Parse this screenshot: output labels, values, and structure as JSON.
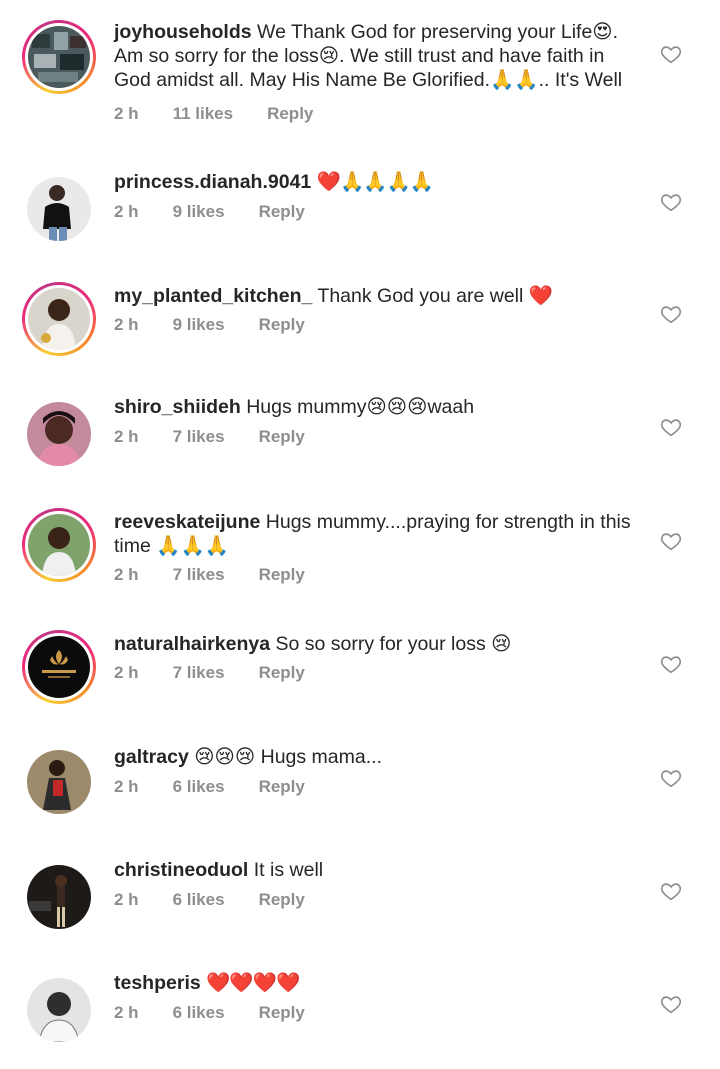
{
  "comments": [
    {
      "username": "joyhouseholds",
      "text": "We Thank God for preserving your Life😍. Am so sorry for the loss😢. We still trust and have faith in God amidst all. May His Name Be Glorified.🙏🙏.. It's Well",
      "time": "2 h",
      "likes": "11 likes",
      "reply": "Reply"
    },
    {
      "username": "princess.dianah.9041",
      "text": "❤️🙏🙏🙏🙏",
      "time": "2 h",
      "likes": "9 likes",
      "reply": "Reply"
    },
    {
      "username": "my_planted_kitchen_",
      "text": "Thank God you are well ❤️",
      "time": "2 h",
      "likes": "9 likes",
      "reply": "Reply"
    },
    {
      "username": "shiro_shiideh",
      "text": "Hugs mummy😢😢😢waah",
      "time": "2 h",
      "likes": "7 likes",
      "reply": "Reply"
    },
    {
      "username": "reeveskateijune",
      "text": "Hugs mummy....praying for strength in this time 🙏🙏🙏",
      "time": "2 h",
      "likes": "7 likes",
      "reply": "Reply"
    },
    {
      "username": "naturalhairkenya",
      "text": "So so sorry for your loss 😢",
      "time": "2 h",
      "likes": "7 likes",
      "reply": "Reply"
    },
    {
      "username": "galtracy",
      "text": "😢😢😢 Hugs mama...",
      "time": "2 h",
      "likes": "6 likes",
      "reply": "Reply"
    },
    {
      "username": "christineoduol",
      "text": "It is well",
      "time": "2 h",
      "likes": "6 likes",
      "reply": "Reply"
    },
    {
      "username": "teshperis",
      "text": "❤️❤️❤️❤️",
      "time": "2 h",
      "likes": "6 likes",
      "reply": "Reply"
    }
  ],
  "icons": {
    "heart": "heart-outline-icon",
    "avatar_ring": "story-ring"
  },
  "colors": {
    "text": "#262626",
    "meta": "#8e8e8e",
    "heart_outline": "#8e8e8e",
    "story_ring_start": "#f9ce34",
    "story_ring_end": "#c13584"
  }
}
